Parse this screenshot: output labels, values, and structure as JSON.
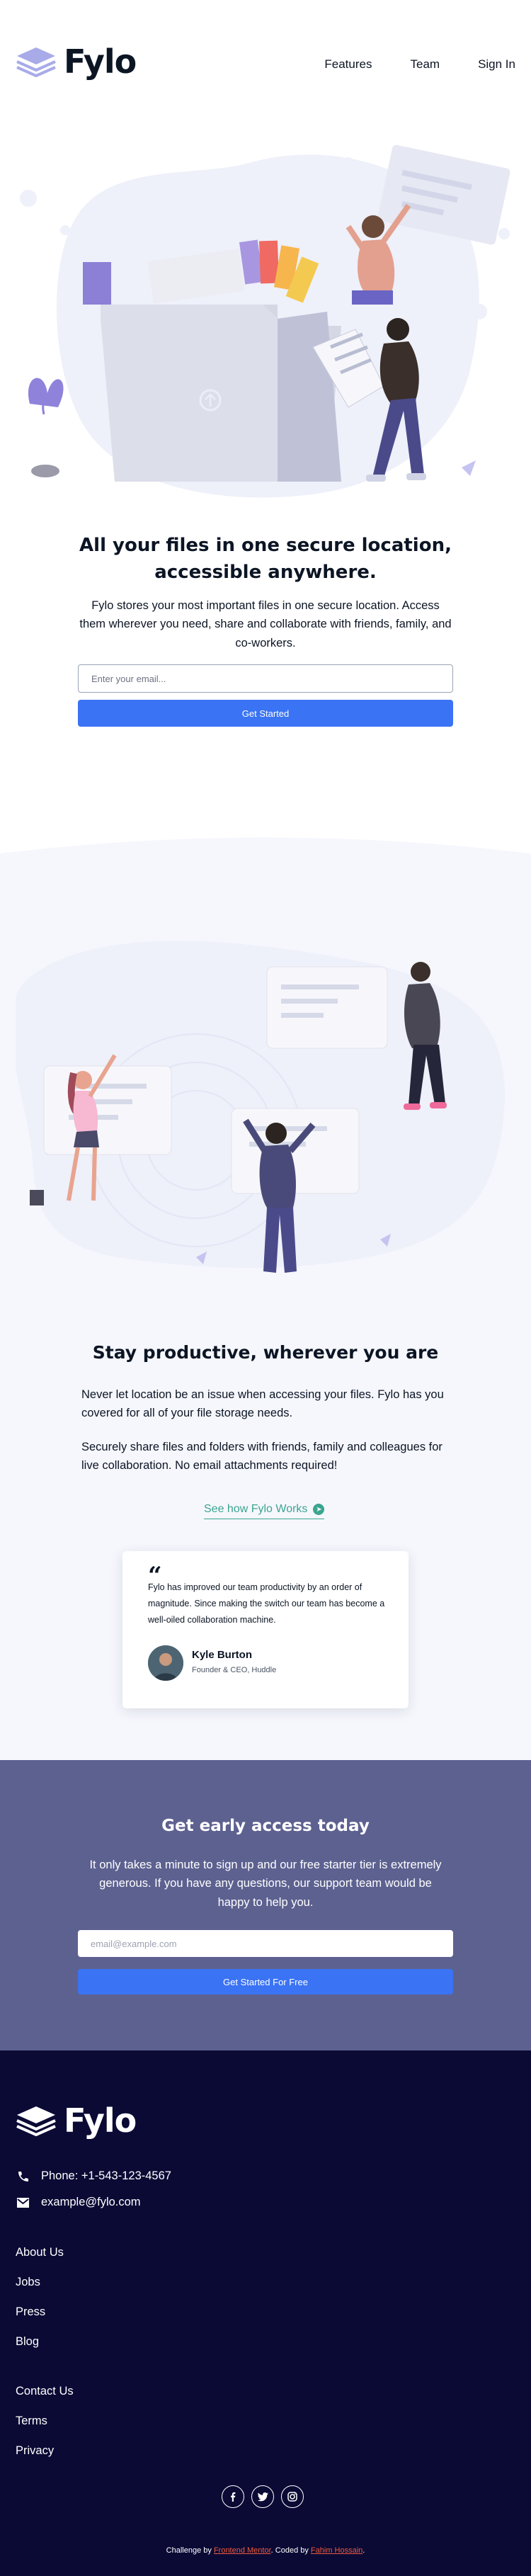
{
  "header": {
    "brand": "Fylo",
    "nav": [
      "Features",
      "Team",
      "Sign In"
    ]
  },
  "hero": {
    "title": "All your files in one secure location, accessible anywhere.",
    "text": "Fylo stores your most important files in one secure location. Access them wherever you need, share and collaborate with friends, family, and co-workers.",
    "email_placeholder": "Enter your email...",
    "button": "Get Started"
  },
  "productive": {
    "title": "Stay productive, wherever you are",
    "paragraph1": "Never let location be an issue when accessing your files. Fylo has you covered for all of your file storage needs.",
    "paragraph2": "Securely share files and folders with friends, family and colleagues for live collaboration. No email attachments required!",
    "link": "See how Fylo Works",
    "testimonial": {
      "quote": "Fylo has improved our team productivity by an order of magnitude. Since making the switch our team has become a well-oiled collaboration machine.",
      "author": "Kyle Burton",
      "role": "Founder & CEO, Huddle"
    }
  },
  "early_access": {
    "title": "Get early access today",
    "text": "It only takes a minute to sign up and our free starter tier is extremely generous. If you have any questions, our support team would be happy to help you.",
    "email_placeholder": "email@example.com",
    "button": "Get Started For Free"
  },
  "footer": {
    "brand": "Fylo",
    "phone": "Phone: +1-543-123-4567",
    "email": "example@fylo.com",
    "links_group1": [
      "About Us",
      "Jobs",
      "Press",
      "Blog"
    ],
    "links_group2": [
      "Contact Us",
      "Terms",
      "Privacy"
    ],
    "socials": [
      "facebook-icon",
      "twitter-icon",
      "instagram-icon"
    ],
    "credit": {
      "prefix": "Challenge by ",
      "fm": "Frontend Mentor",
      "mid": ". Coded by ",
      "author": "Fahim Hossain",
      "suffix": "."
    }
  },
  "colors": {
    "primary_blue": "#3a73f3",
    "link_green": "#3ba590",
    "cta_bg": "#5d6190",
    "footer_bg": "#0b0a35",
    "credit_accent": "#f05a3c"
  }
}
